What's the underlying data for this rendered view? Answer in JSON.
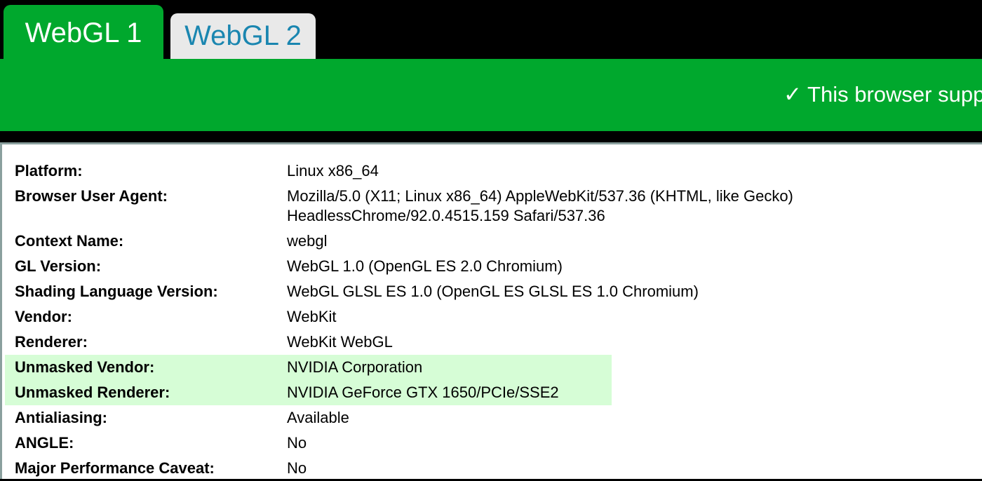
{
  "tabs": [
    {
      "label": "WebGL 1",
      "active": true
    },
    {
      "label": "WebGL 2",
      "active": false
    }
  ],
  "banner": {
    "check_glyph": "✓",
    "text": "This browser supp"
  },
  "rows": [
    {
      "label": "Platform:",
      "value": "Linux x86_64",
      "highlight": false
    },
    {
      "label": "Browser User Agent:",
      "value": "Mozilla/5.0 (X11; Linux x86_64) AppleWebKit/537.36 (KHTML, like Gecko)\nHeadlessChrome/92.0.4515.159 Safari/537.36",
      "highlight": false
    },
    {
      "label": "Context Name:",
      "value": "webgl",
      "highlight": false
    },
    {
      "label": "GL Version:",
      "value": "WebGL 1.0 (OpenGL ES 2.0 Chromium)",
      "highlight": false
    },
    {
      "label": "Shading Language Version:",
      "value": "WebGL GLSL ES 1.0 (OpenGL ES GLSL ES 1.0 Chromium)",
      "highlight": false
    },
    {
      "label": "Vendor:",
      "value": "WebKit",
      "highlight": false
    },
    {
      "label": "Renderer:",
      "value": "WebKit WebGL",
      "highlight": false
    },
    {
      "label": "Unmasked Vendor:",
      "value": "NVIDIA Corporation",
      "highlight": true
    },
    {
      "label": "Unmasked Renderer:",
      "value": "NVIDIA GeForce GTX 1650/PCIe/SSE2",
      "highlight": true
    },
    {
      "label": "Antialiasing:",
      "value": "Available",
      "highlight": false
    },
    {
      "label": "ANGLE:",
      "value": "No",
      "highlight": false
    },
    {
      "label": "Major Performance Caveat:",
      "value": "No",
      "highlight": false
    }
  ],
  "colors": {
    "brand_green": "#00a82d",
    "highlight_row": "#d6fdd6",
    "inactive_tab_text": "#1a86b0",
    "inactive_tab_bg": "#e9e9e9"
  }
}
